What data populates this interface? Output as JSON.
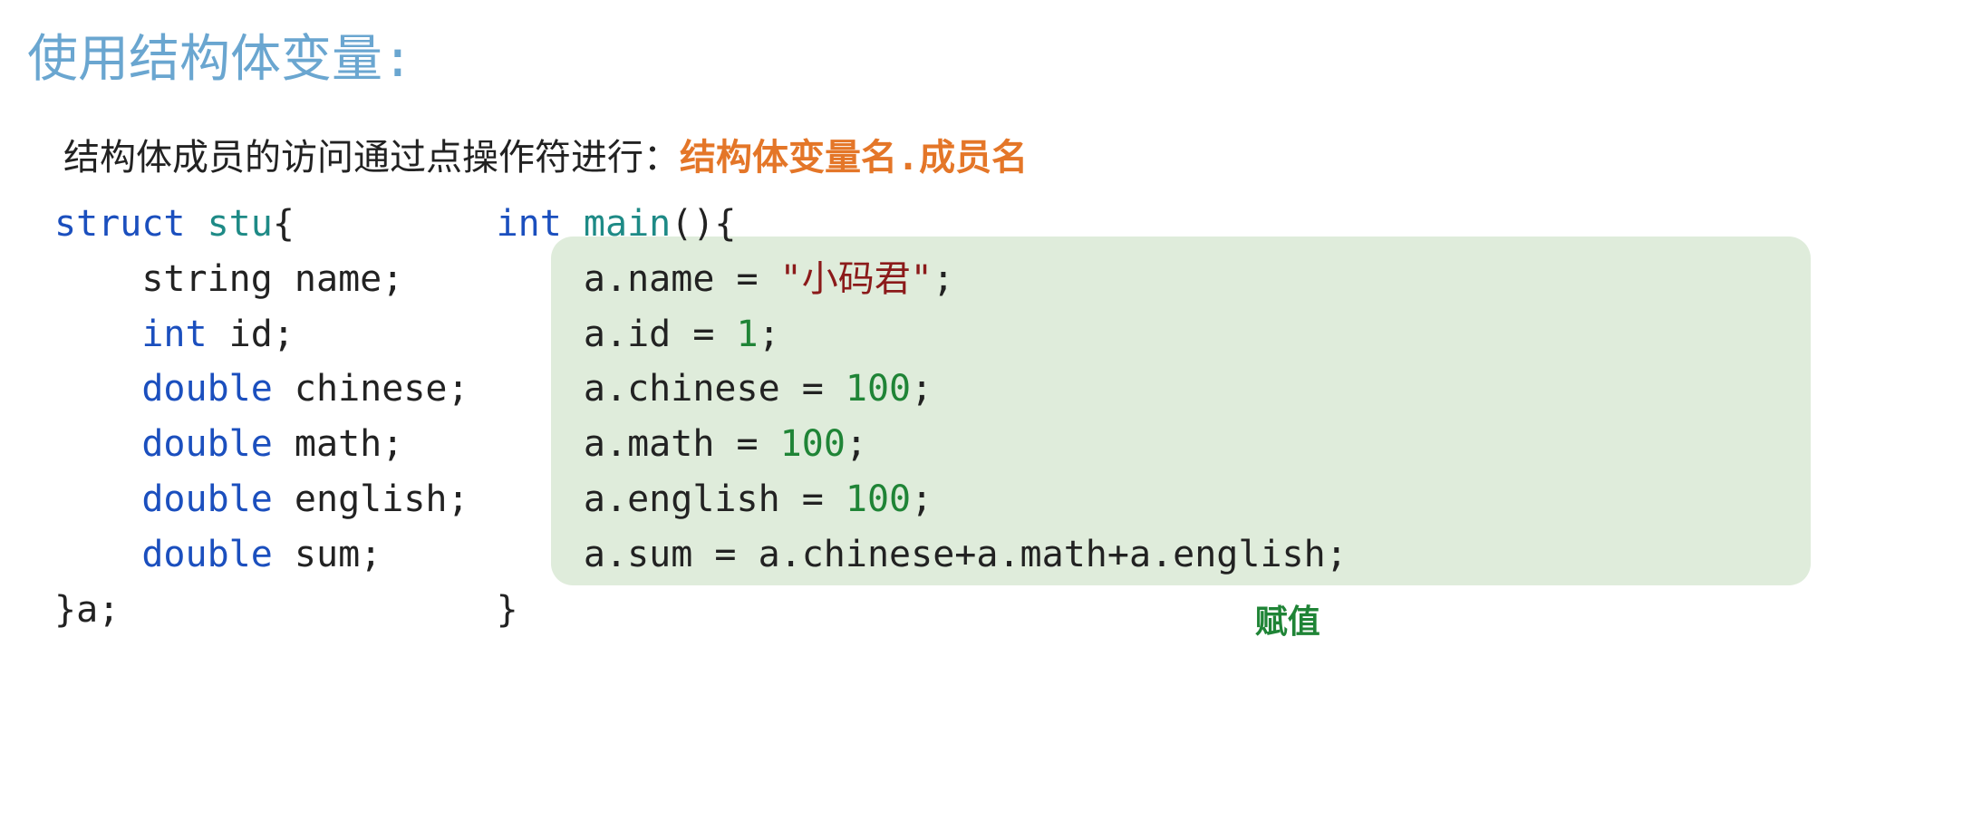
{
  "headline": "使用结构体变量:",
  "subline_prefix": "结构体成员的访问通过点操作符进行：",
  "subline_em": "结构体变量名.成员名",
  "left": {
    "l1a": "struct",
    "l1b": " stu",
    "l1c": "{",
    "l2": "    string name;",
    "l3a": "    ",
    "l3b": "int",
    "l3c": " id;",
    "l4a": "    ",
    "l4b": "double",
    "l4c": " chinese;",
    "l5a": "    ",
    "l5b": "double",
    "l5c": " math;",
    "l6a": "    ",
    "l6b": "double",
    "l6c": " english;",
    "l7a": "    ",
    "l7b": "double",
    "l7c": " sum;",
    "l8": "}a;"
  },
  "right": {
    "l1a": "int",
    "l1b": " main",
    "l1c": "(){",
    "l2a": "    a.name = ",
    "l2b": "\"小码君\"",
    "l2c": ";",
    "l3a": "    a.id = ",
    "l3b": "1",
    "l3c": ";",
    "l4a": "    a.chinese = ",
    "l4b": "100",
    "l4c": ";",
    "l5a": "    a.math = ",
    "l5b": "100",
    "l5c": ";",
    "l6a": "    a.english = ",
    "l6b": "100",
    "l6c": ";",
    "l7": "    a.sum = a.chinese+a.math+a.english;",
    "l8": "}"
  },
  "caption": "赋值"
}
